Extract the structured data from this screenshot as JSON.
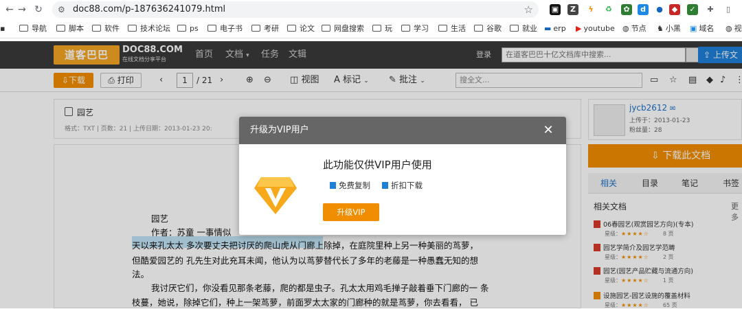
{
  "browser": {
    "url": "doc88.com/p-187636241079.html",
    "bookmarks": [
      "导航",
      "脚本",
      "软件",
      "技术论坛",
      "ps",
      "电子书",
      "考研",
      "论文",
      "网盘搜索",
      "玩",
      "学习",
      "生活",
      "谷歌",
      "就业",
      "erp",
      "youtube",
      "节点",
      "小黑",
      "域名",
      "视"
    ]
  },
  "site": {
    "logo_cn": "道客巴巴",
    "logo_en": "DOC88.COM",
    "logo_sub": "在线文档分享平台",
    "nav": [
      "首页",
      "文档",
      "任务",
      "文辑"
    ],
    "login": "登录",
    "search_placeholder": "在道客巴巴十亿文档库中搜索...",
    "upload": "上传文"
  },
  "toolbar": {
    "download": "下载",
    "print": "打印",
    "page_current": "1",
    "page_total": "/ 21",
    "view": "视图",
    "mark": "标记",
    "annotate": "批注",
    "find_placeholder": "搜全文..."
  },
  "doc": {
    "title": "园艺",
    "meta": "格式：TXT   |   页数：21   |   上传日期：2013-01-23 20:",
    "lines": [
      "园艺",
      "作者：苏童  一事情似",
      "天以来孔太太  多次要丈夫把讨厌的爬山虎从门廊上除掉，在庭院里种上另一种美丽的茑萝，",
      "但酷爱园艺的  孔先生对此充耳未闻，他认为以茑萝替代长了多年的老藤是一种愚蠢无知的想",
      "法。",
      "我讨厌它们，你没看见那条老藤，爬的都是虫子。孔太太用鸡毛掸子敲着垂下门廊的一  条",
      "枝蔓，她说，除掉它们，种上一架茑萝，前面罗太太家的门廊种的就是茑萝，你去看看，  已"
    ]
  },
  "sidebar": {
    "username": "jycb2612",
    "uploaded": "上传于：2013-01-23",
    "fans": "粉丝量：28",
    "download_doc": "下载此文档",
    "tabs": [
      "相关",
      "目录",
      "笔记",
      "书签"
    ],
    "related_header": "相关文档",
    "related_more": "更多",
    "related": [
      {
        "title": "06春园艺(观赏园艺方向)(专本)",
        "rating": "★★★★☆",
        "pages": "8 页"
      },
      {
        "title": "园艺学简介及园艺学范畴",
        "rating": "★★★★☆",
        "pages": "2 页"
      },
      {
        "title": "园艺(园艺产品贮藏与流通方向)",
        "rating": "★★★★☆",
        "pages": "1 页"
      },
      {
        "title": "设施园艺-园艺设施的覆盖材料",
        "rating": "★★★★☆",
        "pages": "65 页"
      }
    ],
    "rating_label": "星级："
  },
  "modal": {
    "header": "升级为VIP用户",
    "close": "✕",
    "title": "此功能仅供VIP用户使用",
    "feature1": "免费复制",
    "feature2": "折扣下载",
    "upgrade": "升级VIP"
  }
}
